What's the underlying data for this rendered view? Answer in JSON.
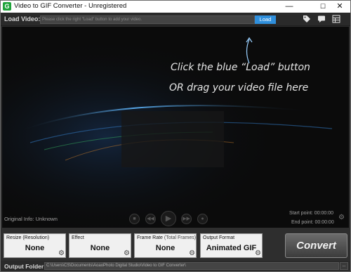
{
  "window": {
    "title": "Video to GIF Converter - Unregistered",
    "minimize": "—",
    "maximize": "☐",
    "close": "✕"
  },
  "load_row": {
    "label": "Load Video:",
    "placeholder": "Please click the right \"Load\" button to add your video.",
    "load_button": "Load",
    "icons": [
      "tag-icon",
      "chat-icon",
      "grid-icon"
    ]
  },
  "preview": {
    "hint_line1": "Click the blue “Load” button",
    "hint_line2": "OR drag your video file here",
    "original_info": "Original Info: Unknown",
    "start_point": "Start point: 00:00:00",
    "end_point": "End point: 00:00:00"
  },
  "options": {
    "resize": {
      "title": "Resize (Resolution)",
      "value": "None"
    },
    "effect": {
      "title": "Effect",
      "value": "None"
    },
    "frame_rate": {
      "title": "Frame Rate",
      "title_sub": "(Total Frames)",
      "value": "None"
    },
    "output_format": {
      "title": "Output Format",
      "value": "Animated GIF"
    }
  },
  "convert_label": "Convert",
  "output": {
    "label": "Output Folder:",
    "path": "C:\\Users\\CS\\Documents\\AoaoPhoto Digital Studio\\Video to GIF Converter\\",
    "browse": "..."
  },
  "colors": {
    "accent": "#2f8fdc",
    "background": "#2e2e2e",
    "preview": "#0b0b0b"
  }
}
